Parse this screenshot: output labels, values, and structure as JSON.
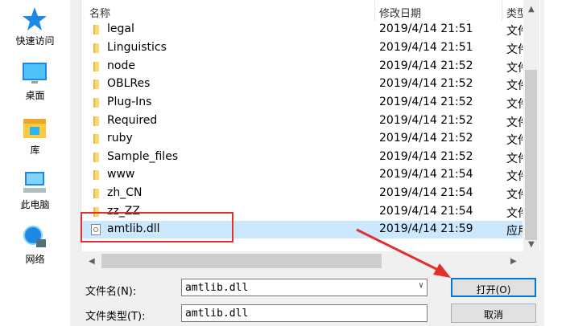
{
  "sidebar": {
    "items": [
      {
        "label": "快速访问",
        "icon": "star-icon"
      },
      {
        "label": "桌面",
        "icon": "desktop-icon"
      },
      {
        "label": "库",
        "icon": "library-icon"
      },
      {
        "label": "此电脑",
        "icon": "computer-icon"
      },
      {
        "label": "网络",
        "icon": "network-icon"
      }
    ]
  },
  "columns": {
    "name": "名称",
    "date": "修改日期",
    "type": "类型"
  },
  "files": [
    {
      "name": "legal",
      "date": "2019/4/14 21:51",
      "type": "文件夹"
    },
    {
      "name": "Linguistics",
      "date": "2019/4/14 21:51",
      "type": "文件夹"
    },
    {
      "name": "node",
      "date": "2019/4/14 21:52",
      "type": "文件夹"
    },
    {
      "name": "OBLRes",
      "date": "2019/4/14 21:52",
      "type": "文件夹"
    },
    {
      "name": "Plug-Ins",
      "date": "2019/4/14 21:52",
      "type": "文件夹"
    },
    {
      "name": "Required",
      "date": "2019/4/14 21:52",
      "type": "文件夹"
    },
    {
      "name": "ruby",
      "date": "2019/4/14 21:52",
      "type": "文件夹"
    },
    {
      "name": "Sample_files",
      "date": "2019/4/14 21:52",
      "type": "文件夹"
    },
    {
      "name": "www",
      "date": "2019/4/14 21:54",
      "type": "文件夹"
    },
    {
      "name": "zh_CN",
      "date": "2019/4/14 21:54",
      "type": "文件夹"
    },
    {
      "name": "zz_ZZ",
      "date": "2019/4/14 21:54",
      "type": "文件夹"
    },
    {
      "name": "amtlib.dll",
      "date": "2019/4/14 21:59",
      "type": "应用程序扩展"
    }
  ],
  "selected_file": "amtlib.dll",
  "filename": {
    "label": "文件名(N):",
    "value": "amtlib.dll"
  },
  "filetype": {
    "label": "文件类型(T):",
    "value": "amtlib.dll"
  },
  "buttons": {
    "open": "打开(O)",
    "cancel": "取消"
  },
  "colors": {
    "selection": "#cce8ff",
    "highlight_box": "#e0322b",
    "folder": "#f8d775",
    "primary_border": "#0078d7"
  }
}
